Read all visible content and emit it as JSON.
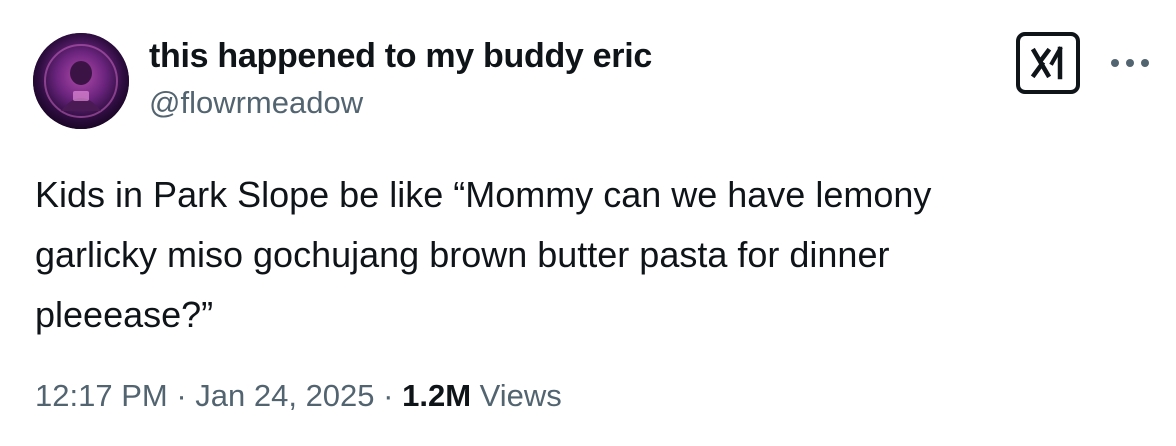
{
  "author": {
    "display_name": "this happened to my buddy eric",
    "handle": "@flowrmeadow"
  },
  "tweet": {
    "text": "Kids in Park Slope be like “Mommy can we have lemony\ngarlicky miso gochujang brown butter pasta for dinner\npleeease?”"
  },
  "meta": {
    "time": "12:17 PM",
    "separator": " · ",
    "date": "Jan 24, 2025",
    "views_count": "1.2M",
    "views_label": "Views"
  },
  "icons": {
    "grok": "grok-icon",
    "more": "more-icon",
    "avatar": "avatar-image"
  },
  "colors": {
    "text_primary": "#0f1419",
    "text_secondary": "#536471",
    "avatar_accent": "#8a2f8e"
  }
}
